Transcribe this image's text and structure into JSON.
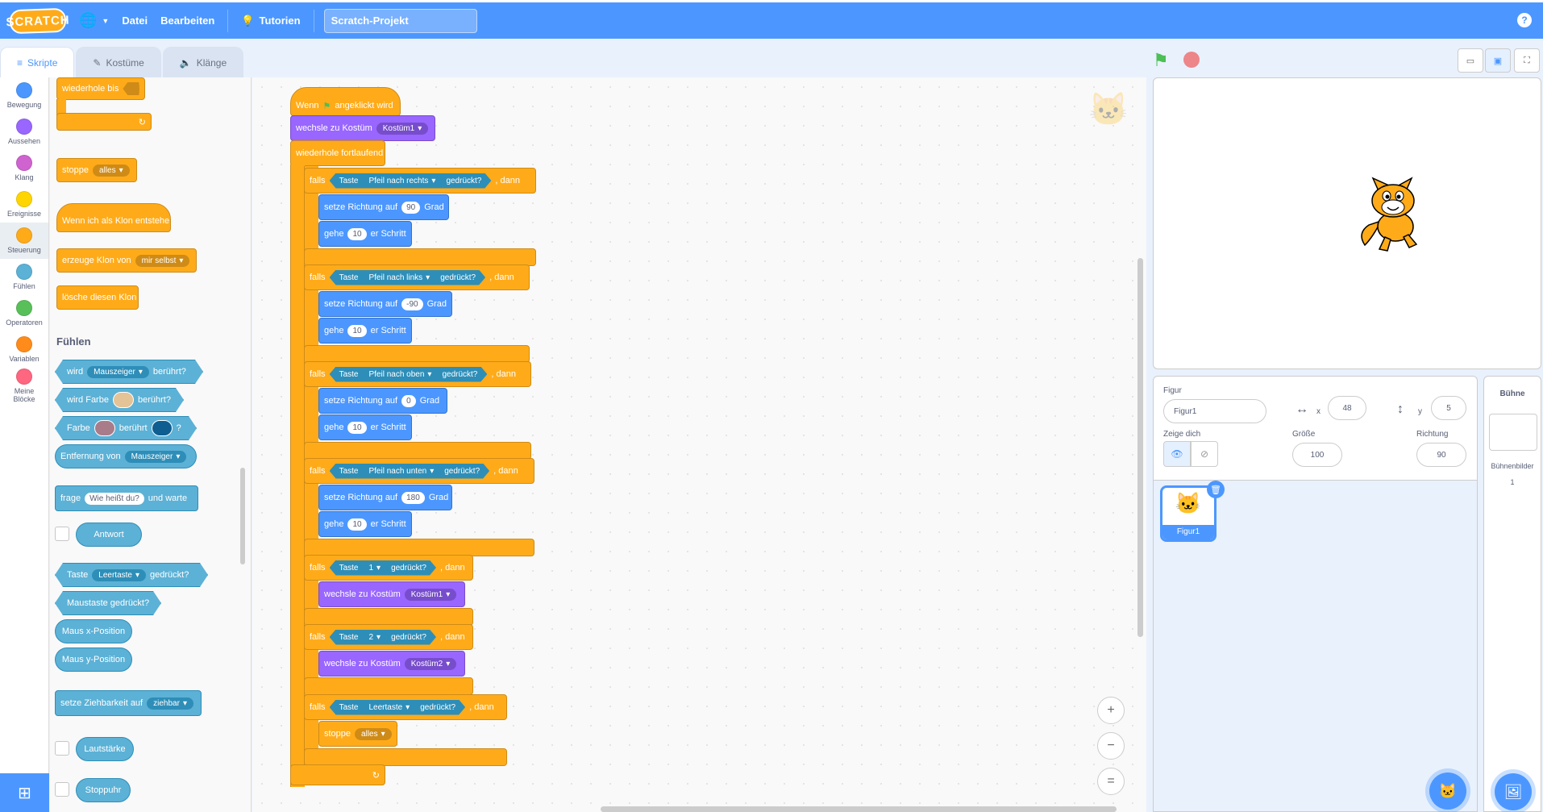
{
  "menubar": {
    "logo": "SCRATCH",
    "file": "Datei",
    "edit": "Bearbeiten",
    "tutorials": "Tutorien",
    "project_title": "Scratch-Projekt",
    "help": "?"
  },
  "tabs": {
    "code": "Skripte",
    "costumes": "Kostüme",
    "sounds": "Klänge"
  },
  "categories": [
    {
      "label": "Bewegung",
      "color": "#4c97ff"
    },
    {
      "label": "Aussehen",
      "color": "#9966ff"
    },
    {
      "label": "Klang",
      "color": "#cf63cf"
    },
    {
      "label": "Ereignisse",
      "color": "#ffd500"
    },
    {
      "label": "Steuerung",
      "color": "#ffab19"
    },
    {
      "label": "Fühlen",
      "color": "#5cb1d6"
    },
    {
      "label": "Operatoren",
      "color": "#59c059"
    },
    {
      "label": "Variablen",
      "color": "#ff8c1a"
    },
    {
      "label": "Meine Blöcke",
      "color": "#ff6680"
    }
  ],
  "palette": {
    "repeat_until": "wiederhole bis",
    "stop": "stoppe",
    "stop_opt": "alles",
    "when_clone": "Wenn ich als Klon entstehe",
    "create_clone": "erzeuge Klon von",
    "create_clone_opt": "mir selbst",
    "delete_clone": "lösche diesen Klon",
    "sensing_title": "Fühlen",
    "touching": "wird",
    "touching_opt": "Mauszeiger",
    "touching_end": "berührt?",
    "touch_color": "wird Farbe",
    "touch_color_end": "berührt?",
    "color": "Farbe",
    "color_mid": "berührt",
    "color_end": "?",
    "distance": "Entfernung von",
    "distance_opt": "Mauszeiger",
    "ask": "frage",
    "ask_val": "Wie heißt du?",
    "ask_end": "und warte",
    "answer": "Antwort",
    "key": "Taste",
    "key_opt": "Leertaste",
    "key_end": "gedrückt?",
    "mouse_down": "Maustaste gedrückt?",
    "mouse_x": "Maus x-Position",
    "mouse_y": "Maus y-Position",
    "drag": "setze Ziehbarkeit auf",
    "drag_opt": "ziehbar",
    "loudness": "Lautstärke",
    "timer": "Stoppuhr"
  },
  "script": {
    "hat_when": "Wenn",
    "hat_end": "angeklickt wird",
    "switch_costume": "wechsle zu Kostüm",
    "costume1": "Kostüm1",
    "costume2": "Kostüm2",
    "forever": "wiederhole fortlaufend",
    "if": "falls",
    "then": ", dann",
    "key": "Taste",
    "pressed": "gedrückt?",
    "point_dir": "setze Richtung auf",
    "degrees": "Grad",
    "move": "gehe",
    "steps": "er Schritt",
    "move_val": "10",
    "stop": "stoppe",
    "stop_opt": "alles",
    "branches": [
      {
        "key": "Pfeil nach rechts",
        "dir": "90"
      },
      {
        "key": "Pfeil nach links",
        "dir": "-90"
      },
      {
        "key": "Pfeil nach oben",
        "dir": "0"
      },
      {
        "key": "Pfeil nach unten",
        "dir": "180"
      }
    ],
    "key_1": "1",
    "key_2": "2",
    "key_space": "Leertaste"
  },
  "zoom": {
    "in": "+",
    "out": "−",
    "reset": "="
  },
  "sprite": {
    "label": "Figur",
    "name": "Figur1",
    "x_label": "x",
    "x": "48",
    "y_label": "y",
    "y": "5",
    "show_label": "Zeige dich",
    "size_label": "Größe",
    "size": "100",
    "dir_label": "Richtung",
    "direction": "90",
    "thumb_name": "Figur1"
  },
  "stage_pane": {
    "title": "Bühne",
    "backdrops_label": "Bühnenbilder",
    "backdrops_count": "1"
  }
}
